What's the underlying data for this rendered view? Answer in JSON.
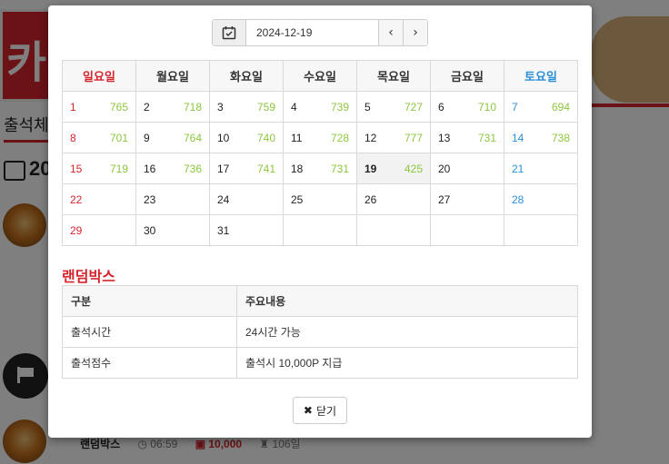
{
  "background": {
    "logo_text": "카",
    "page_title": "출석체",
    "calendar_heading": "20",
    "row": {
      "name": "랜덤박스",
      "time": "06:59",
      "points": "10,000",
      "days": "106일"
    }
  },
  "modal": {
    "date_value": "2024-12-19",
    "prev_label": "‹",
    "next_label": "›",
    "weekdays": [
      "일요일",
      "월요일",
      "화요일",
      "수요일",
      "목요일",
      "금요일",
      "토요일"
    ],
    "weeks": [
      [
        {
          "d": "1",
          "s": "765"
        },
        {
          "d": "2",
          "s": "718"
        },
        {
          "d": "3",
          "s": "759"
        },
        {
          "d": "4",
          "s": "739"
        },
        {
          "d": "5",
          "s": "727"
        },
        {
          "d": "6",
          "s": "710"
        },
        {
          "d": "7",
          "s": "694"
        }
      ],
      [
        {
          "d": "8",
          "s": "701"
        },
        {
          "d": "9",
          "s": "764"
        },
        {
          "d": "10",
          "s": "740"
        },
        {
          "d": "11",
          "s": "728"
        },
        {
          "d": "12",
          "s": "777"
        },
        {
          "d": "13",
          "s": "731"
        },
        {
          "d": "14",
          "s": "738"
        }
      ],
      [
        {
          "d": "15",
          "s": "719"
        },
        {
          "d": "16",
          "s": "736"
        },
        {
          "d": "17",
          "s": "741"
        },
        {
          "d": "18",
          "s": "731"
        },
        {
          "d": "19",
          "s": "425"
        },
        {
          "d": "20",
          "s": ""
        },
        {
          "d": "21",
          "s": ""
        }
      ],
      [
        {
          "d": "22",
          "s": ""
        },
        {
          "d": "23",
          "s": ""
        },
        {
          "d": "24",
          "s": ""
        },
        {
          "d": "25",
          "s": ""
        },
        {
          "d": "26",
          "s": ""
        },
        {
          "d": "27",
          "s": ""
        },
        {
          "d": "28",
          "s": ""
        }
      ],
      [
        {
          "d": "29",
          "s": ""
        },
        {
          "d": "30",
          "s": ""
        },
        {
          "d": "31",
          "s": ""
        },
        {
          "d": "",
          "s": ""
        },
        {
          "d": "",
          "s": ""
        },
        {
          "d": "",
          "s": ""
        },
        {
          "d": "",
          "s": ""
        }
      ]
    ],
    "today": "19",
    "section_title": "랜덤박스",
    "info_headers": [
      "구분",
      "주요내용"
    ],
    "info_rows": [
      [
        "출석시간",
        "24시간 가능"
      ],
      [
        "출석점수",
        "출석시 10,000P 지급"
      ]
    ],
    "close_label": "닫기",
    "colors": {
      "sunday": "#d6242c",
      "saturday": "#2a8fd8",
      "score": "#8cc63f"
    }
  }
}
